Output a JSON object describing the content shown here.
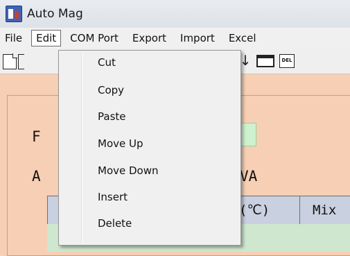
{
  "window": {
    "title": "Auto Mag"
  },
  "menubar": [
    {
      "label": "File"
    },
    {
      "label": "Edit",
      "active": true
    },
    {
      "label": "COM Port"
    },
    {
      "label": "Export"
    },
    {
      "label": "Import"
    },
    {
      "label": "Excel"
    }
  ],
  "toolbar": {
    "icons": [
      "new-file-icon",
      "open-folder-icon",
      "down-arrow-icon",
      "window-icon",
      "delete-icon"
    ],
    "down_glyph": "↓",
    "del_label": "DEL"
  },
  "content": {
    "row1_label": "F",
    "row2_label": "A",
    "row2_suffix": "VA",
    "grid_col1": "(℃)",
    "grid_col2": "Mix"
  },
  "edit_menu": {
    "items": [
      "Cut",
      "Copy",
      "Paste",
      "Move Up",
      "Move Down",
      "Insert",
      "Delete"
    ]
  },
  "colors": {
    "background": "#f6cfb4",
    "menu_bg": "#f0f0f0",
    "field_green": "#ccf2cf",
    "grid_header": "#c9d0df"
  }
}
